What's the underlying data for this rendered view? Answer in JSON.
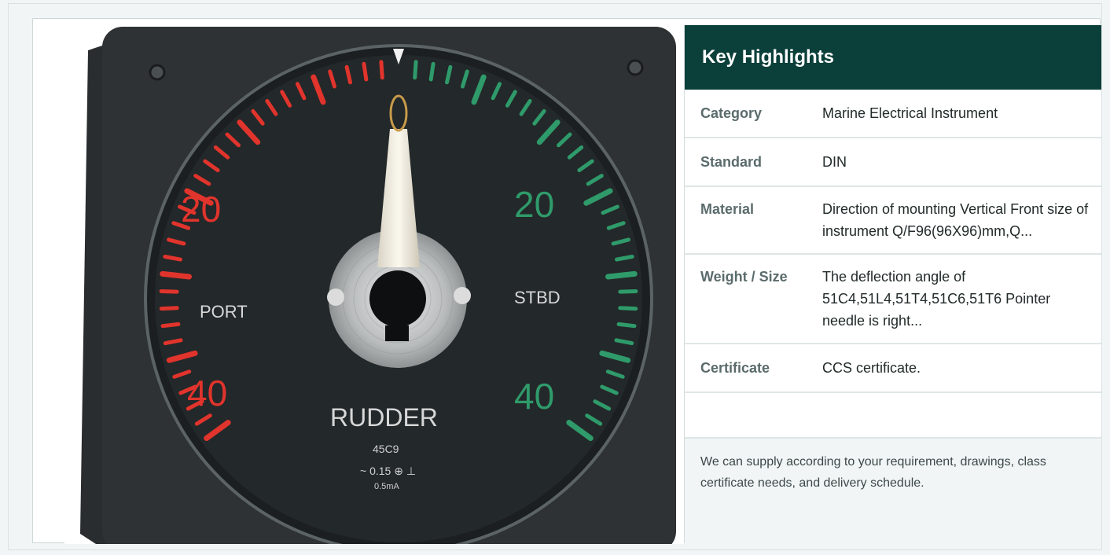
{
  "dial": {
    "left_number_top": "20",
    "left_number_bottom": "40",
    "right_number_top": "20",
    "right_number_bottom": "40",
    "port_label": "PORT",
    "stbd_label": "STBD",
    "name_label": "RUDDER",
    "model_label": "45C9",
    "spec_line": "~ 0.15 ⊕ ⊥",
    "current_label": "0.5mA"
  },
  "highlights": {
    "title": "Key Highlights",
    "rows": [
      {
        "label": "Category",
        "value": "Marine Electrical Instrument"
      },
      {
        "label": "Standard",
        "value": "DIN"
      },
      {
        "label": "Material",
        "value": "Direction of mounting Vertical Front size of instrument Q/F96(96X96)mm,Q..."
      },
      {
        "label": "Weight / Size",
        "value": "The deflection angle of 51C4,51L4,51T4,51C6,51T6 Pointer needle is right..."
      },
      {
        "label": "Certificate",
        "value": "CCS certificate."
      }
    ],
    "note": "We can supply according to your requirement, drawings, class certificate needs, and delivery schedule."
  },
  "colors": {
    "header_bg": "#0b3f3a",
    "port_red": "#e0342c",
    "stbd_green": "#2f9a6a"
  }
}
